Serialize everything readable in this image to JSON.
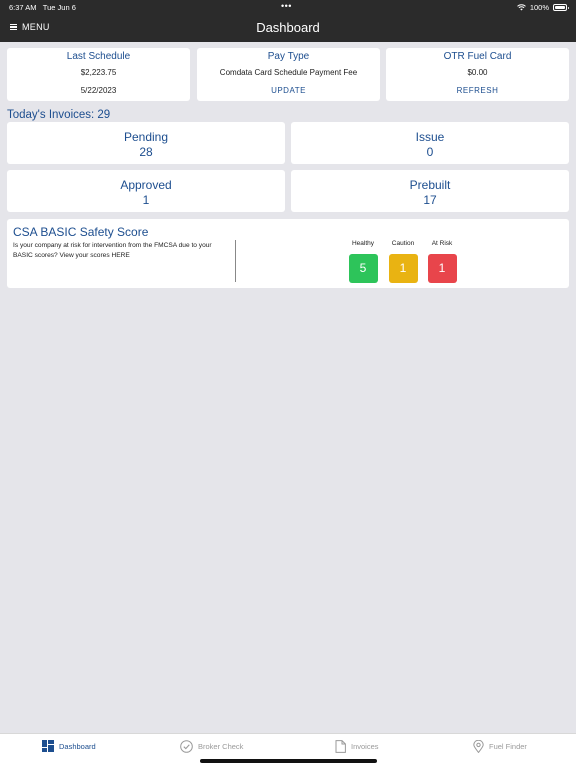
{
  "status_bar": {
    "time": "6:37 AM",
    "date": "Tue Jun 6",
    "battery": "100%"
  },
  "nav": {
    "menu_label": "MENU",
    "title": "Dashboard"
  },
  "top_cards": {
    "last_schedule": {
      "title": "Last Schedule",
      "amount": "$2,223.75",
      "date": "5/22/2023"
    },
    "pay_type": {
      "title": "Pay Type",
      "value": "Comdata Card Schedule Payment Fee",
      "action": "UPDATE"
    },
    "fuel_card": {
      "title": "OTR Fuel Card",
      "value": "$0.00",
      "action": "REFRESH"
    }
  },
  "invoices": {
    "heading": "Today's Invoices: 29",
    "pending": {
      "label": "Pending",
      "count": "28"
    },
    "issue": {
      "label": "Issue",
      "count": "0"
    },
    "approved": {
      "label": "Approved",
      "count": "1"
    },
    "prebuilt": {
      "label": "Prebuilt",
      "count": "17"
    }
  },
  "csa": {
    "title": "CSA BASIC Safety Score",
    "description": "Is your company at risk for intervention from the FMCSA due to your BASIC scores? View your scores HERE",
    "scores": {
      "healthy": {
        "label": "Healthy",
        "value": "5",
        "color": "#2dc45a"
      },
      "caution": {
        "label": "Caution",
        "value": "1",
        "color": "#e9b312"
      },
      "at_risk": {
        "label": "At Risk",
        "value": "1",
        "color": "#e8454b"
      }
    }
  },
  "tabs": {
    "dashboard": {
      "label": "Dashboard",
      "icon": "dashboard-icon"
    },
    "broker_check": {
      "label": "Broker Check",
      "icon": "check-circle-icon"
    },
    "invoices": {
      "label": "Invoices",
      "icon": "document-icon"
    },
    "fuel_finder": {
      "label": "Fuel Finder",
      "icon": "location-pin-icon"
    }
  },
  "colors": {
    "accent": "#1d4e8f",
    "bar": "#2b2b2b",
    "background": "#e5e5ea"
  }
}
